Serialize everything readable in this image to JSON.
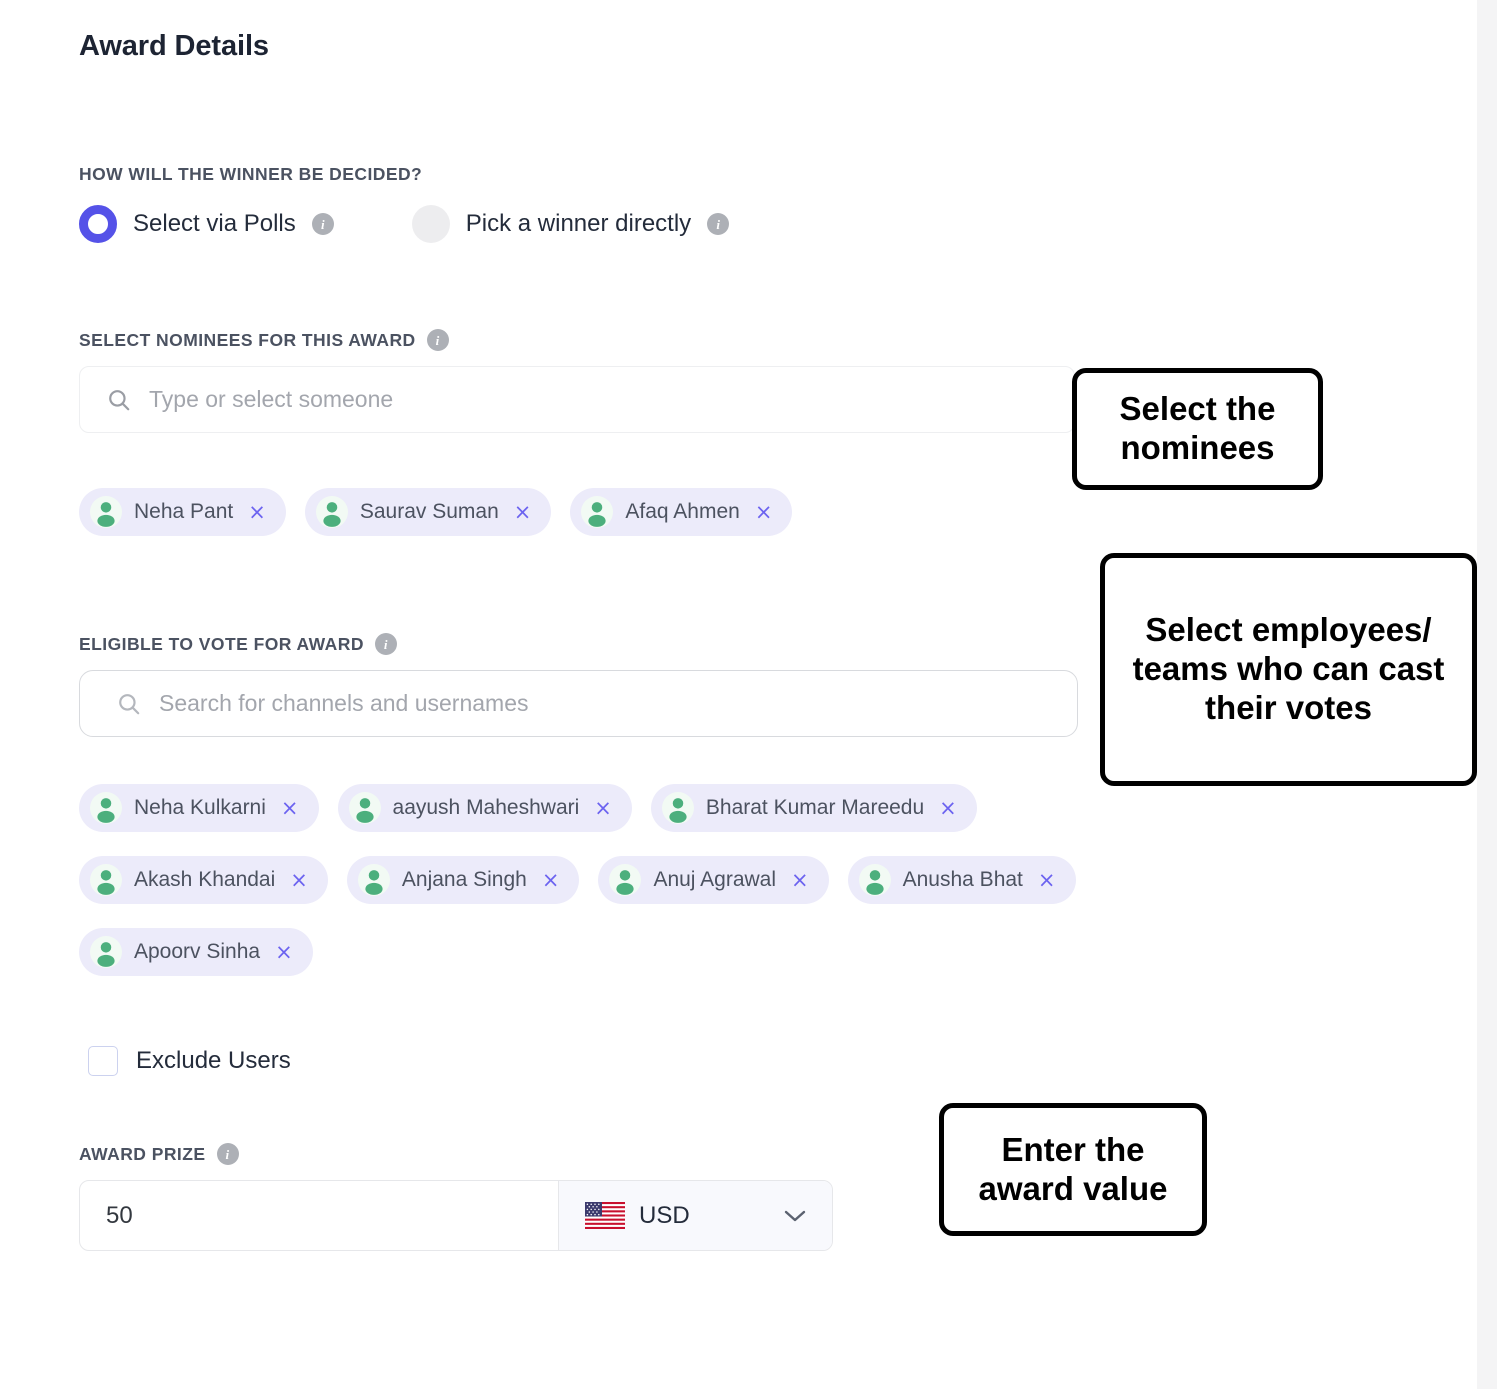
{
  "page": {
    "title": "Award Details"
  },
  "decision": {
    "label": "HOW WILL THE WINNER BE DECIDED?",
    "options": [
      {
        "label": "Select via Polls",
        "selected": true,
        "info": "info-icon"
      },
      {
        "label": "Pick a winner directly",
        "selected": false,
        "info": "info-icon"
      }
    ]
  },
  "nominees": {
    "label": "SELECT NOMINEES FOR THIS AWARD",
    "placeholder": "Type or select someone",
    "chips": [
      {
        "name": "Neha Pant",
        "remove": "×"
      },
      {
        "name": "Saurav Suman",
        "remove": "×"
      },
      {
        "name": "Afaq Ahmen",
        "remove": "×"
      }
    ]
  },
  "voters": {
    "label": "ELIGIBLE TO VOTE FOR AWARD",
    "placeholder": "Search for channels and usernames",
    "rows": [
      [
        {
          "name": "Neha Kulkarni",
          "remove": "×"
        },
        {
          "name": "aayush Maheshwari",
          "remove": "×"
        },
        {
          "name": "Bharat Kumar Mareedu",
          "remove": "×"
        }
      ],
      [
        {
          "name": "Akash Khandai",
          "remove": "×"
        },
        {
          "name": "Anjana Singh",
          "remove": "×"
        },
        {
          "name": "Anuj Agrawal",
          "remove": "×"
        },
        {
          "name": "Anusha Bhat",
          "remove": "×"
        }
      ],
      [
        {
          "name": "Apoorv Sinha",
          "remove": "×"
        }
      ]
    ]
  },
  "exclude": {
    "label": "Exclude Users",
    "checked": false
  },
  "prize": {
    "label": "AWARD PRIZE",
    "value": "50",
    "currency": "USD",
    "flag": "us-flag-icon"
  },
  "callouts": {
    "nominees": "Select the nominees",
    "voters": "Select employees/ teams who can cast their votes",
    "prize": "Enter the award value"
  },
  "colors": {
    "accent": "#5552e8",
    "chip_bg": "#ecebfa",
    "chip_x": "#6c63f0",
    "avatar_green": "#4caf7d",
    "label_gray": "#4b5261",
    "info_gray": "#adb0b6"
  }
}
